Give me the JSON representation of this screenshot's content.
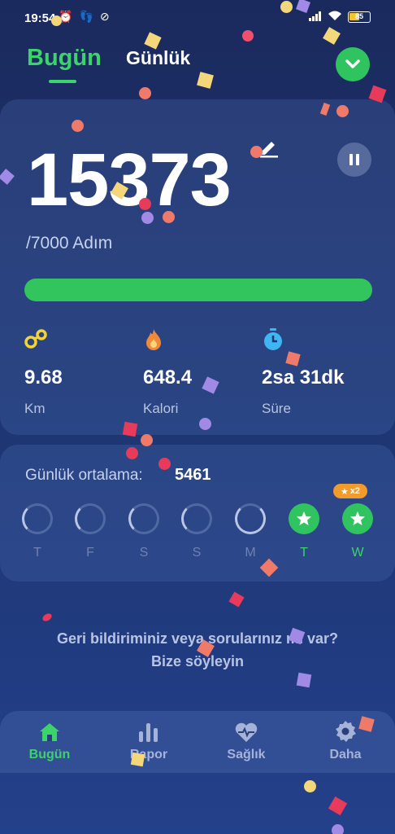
{
  "status_bar": {
    "time": "19:54",
    "battery": "85"
  },
  "tabs": {
    "today": "Bugün",
    "daily": "Günlük"
  },
  "main": {
    "steps": "15373",
    "goal": "/7000 Adım",
    "progress": 1.0,
    "stats": [
      {
        "value": "9.68",
        "label": "Km",
        "icon": "route-icon"
      },
      {
        "value": "648.4",
        "label": "Kalori",
        "icon": "flame-icon"
      },
      {
        "value": "2sa 31dk",
        "label": "Süre",
        "icon": "timer-icon"
      }
    ]
  },
  "average": {
    "label": "Günlük ortalama:",
    "value": "5461",
    "badge": "x2",
    "days": [
      "T",
      "F",
      "S",
      "S",
      "M",
      "T",
      "W"
    ]
  },
  "feedback": {
    "line1": "Geri bildiriminiz veya sorularınız mı var?",
    "line2": "Bize söyleyin"
  },
  "nav": {
    "today": "Bugün",
    "report": "Rapor",
    "health": "Sağlık",
    "more": "Daha"
  },
  "colors": {
    "accent_green": "#3bd36a",
    "background": "#1d3470",
    "badge_orange": "#f29a2a"
  }
}
